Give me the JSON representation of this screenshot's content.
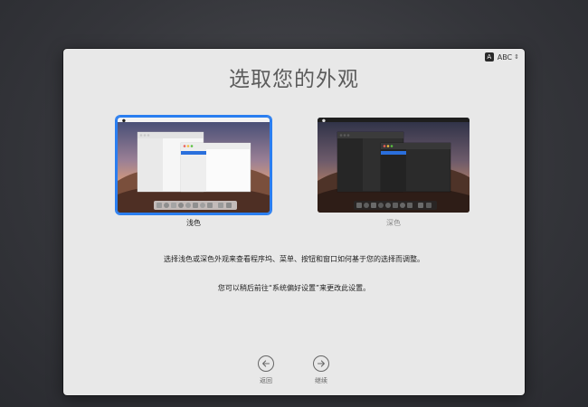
{
  "window": {
    "title": "选取您的外观"
  },
  "input_menu": {
    "icon_letter": "A",
    "label": "ABC",
    "icon": "chevron-updown-icon"
  },
  "appearance": {
    "options": [
      {
        "id": "light",
        "label": "浅色",
        "selected": true
      },
      {
        "id": "dark",
        "label": "深色",
        "selected": false
      }
    ]
  },
  "description": "选择浅色或深色外观来查看程序坞、菜单、按钮和窗口如何基于您的选择而调整。",
  "note": "您可以稍后前往“系统偏好设置”来更改此设置。",
  "nav": {
    "back": {
      "label": "返回",
      "icon": "arrow-left-circle-icon"
    },
    "next": {
      "label": "继续",
      "icon": "arrow-right-circle-icon"
    }
  },
  "colors": {
    "accent": "#2a7ef0",
    "panel_bg": "#e8e8e8",
    "desktop_bg": "#38393e"
  }
}
